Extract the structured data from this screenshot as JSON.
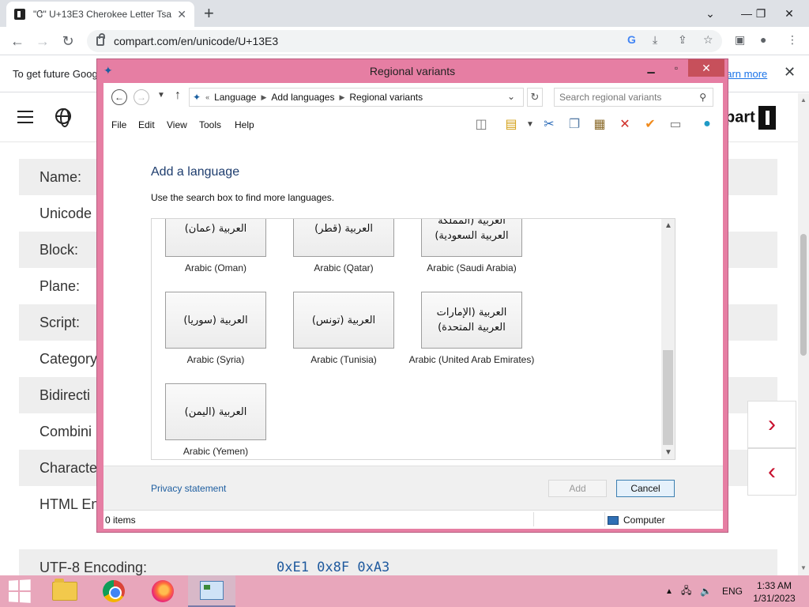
{
  "browser": {
    "tab_title": "\"Ꮳ\" U+13E3 Cherokee Letter Tsa",
    "tab_close": "✕",
    "new_tab": "+",
    "url": "compart.com/en/unicode/U+13E3",
    "win_min": "⌄",
    "win_restore": "❐",
    "win_close": "✕",
    "infobar_text": "To get future Goog",
    "infobar_link": "earn more",
    "infobar_close": "✕"
  },
  "page": {
    "logo_text": "part",
    "rows": [
      {
        "label": "Name:",
        "value": ""
      },
      {
        "label": "Unicode",
        "value": ""
      },
      {
        "label": "Block:",
        "value": ""
      },
      {
        "label": "Plane:",
        "value": ""
      },
      {
        "label": "Script:",
        "value": ""
      },
      {
        "label": "Category",
        "value": ""
      },
      {
        "label": "Bidirecti",
        "value": ""
      },
      {
        "label": "Combini",
        "value": ""
      },
      {
        "label": "Characte",
        "value": ""
      },
      {
        "label": "HTML En",
        "value": ""
      },
      {
        "label": "UTF-8 Encoding:",
        "value": "0xE1 0x8F 0xA3"
      }
    ],
    "next_arrow": "›",
    "prev_arrow": "‹"
  },
  "dialog": {
    "title": "Regional variants",
    "breadcrumb": [
      "Language",
      "Add languages",
      "Regional variants"
    ],
    "search_placeholder": "Search regional variants",
    "menu": [
      "File",
      "Edit",
      "View",
      "Tools",
      "Help"
    ],
    "heading": "Add a language",
    "subheading": "Use the search box to find more languages.",
    "languages": [
      {
        "native": "العربية (عمان)",
        "caption": "Arabic (Oman)"
      },
      {
        "native": "العربية (قطر)",
        "caption": "Arabic (Qatar)"
      },
      {
        "native": "العربية (المملكة العربية السعودية)",
        "caption": "Arabic (Saudi Arabia)"
      },
      {
        "native": "العربية (سوريا)",
        "caption": "Arabic (Syria)"
      },
      {
        "native": "العربية (تونس)",
        "caption": "Arabic (Tunisia)"
      },
      {
        "native": "العربية (الإمارات العربية المتحدة)",
        "caption": "Arabic (United Arab Emirates)"
      },
      {
        "native": "العربية (اليمن)",
        "caption": "Arabic (Yemen)"
      }
    ],
    "privacy_link": "Privacy statement",
    "add_button": "Add",
    "cancel_button": "Cancel",
    "status_items": "0 items",
    "status_location": "Computer"
  },
  "taskbar": {
    "language": "ENG",
    "time": "1:33 AM",
    "date": "1/31/2023"
  }
}
